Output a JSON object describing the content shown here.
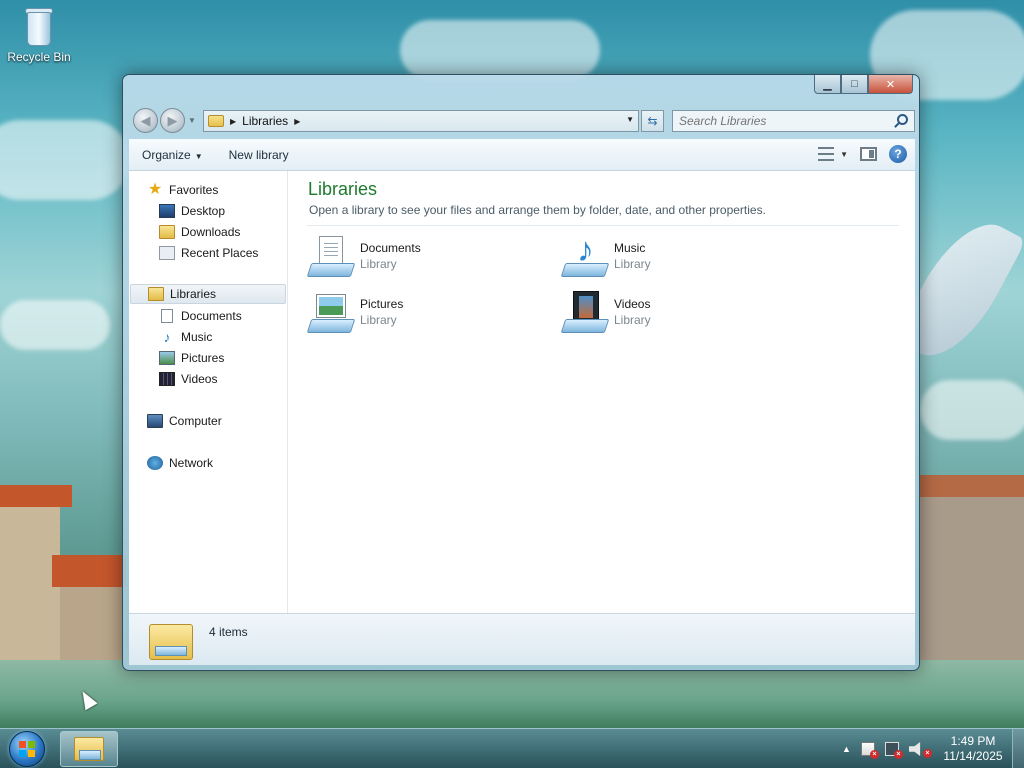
{
  "desktop": {
    "recycle_bin_label": "Recycle Bin"
  },
  "window": {
    "caption": {
      "minimize": "▁",
      "maximize": "□",
      "close": "✕"
    },
    "nav": {
      "back_icon": "back-arrow-icon",
      "forward_icon": "forward-arrow-icon",
      "address_path": "Libraries",
      "refresh_icon": "refresh-icon",
      "search_placeholder": "Search Libraries"
    },
    "toolbar": {
      "organize_label": "Organize",
      "new_library_label": "New library"
    },
    "navpane": {
      "favorites": "Favorites",
      "desktop": "Desktop",
      "downloads": "Downloads",
      "recent_places": "Recent Places",
      "libraries": "Libraries",
      "documents": "Documents",
      "music": "Music",
      "pictures": "Pictures",
      "videos": "Videos",
      "computer": "Computer",
      "network": "Network"
    },
    "main": {
      "title": "Libraries",
      "subtitle": "Open a library to see your files and arrange them by folder, date, and other properties.",
      "libraries": [
        {
          "name": "Documents",
          "kind": "Library",
          "icon": "documents-library-icon"
        },
        {
          "name": "Music",
          "kind": "Library",
          "icon": "music-library-icon"
        },
        {
          "name": "Pictures",
          "kind": "Library",
          "icon": "pictures-library-icon"
        },
        {
          "name": "Videos",
          "kind": "Library",
          "icon": "videos-library-icon"
        }
      ]
    },
    "details": {
      "item_count": "4 items"
    }
  },
  "taskbar": {
    "clock_time": "1:49 PM",
    "clock_date": "11/14/2025"
  },
  "colors": {
    "title_green": "#1e7a2e",
    "link_blue": "#2e6fa8"
  }
}
